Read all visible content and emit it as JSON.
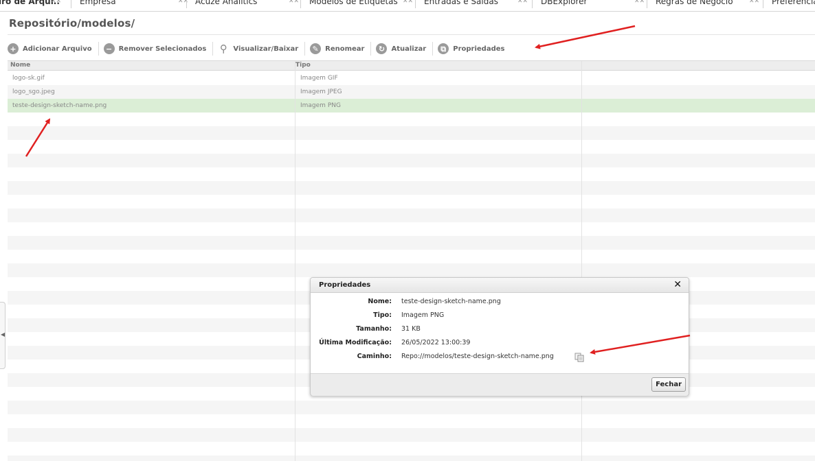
{
  "tabs": [
    {
      "label": "iro de Arqui.."
    },
    {
      "label": "Empresa"
    },
    {
      "label": "Acuze Analitics"
    },
    {
      "label": "Modelos de Etiquetas"
    },
    {
      "label": "Entradas e Saídas"
    },
    {
      "label": "DBExplorer"
    },
    {
      "label": "Regras de Negócio"
    },
    {
      "label": "Preferencias"
    }
  ],
  "header": {
    "title": "Repositório/modelos/"
  },
  "toolbar": {
    "add_label": "Adicionar Arquivo",
    "remove_label": "Remover Selecionados",
    "view_label": "Visualizar/Baixar",
    "rename_label": "Renomear",
    "refresh_label": "Atualizar",
    "properties_label": "Propriedades"
  },
  "grid": {
    "columns": [
      "Nome",
      "Tipo"
    ],
    "rows": [
      {
        "name": "logo-sk.gif",
        "type": "Imagem GIF"
      },
      {
        "name": "logo_sgo.jpeg",
        "type": "Imagem JPEG"
      },
      {
        "name": "teste-design-sketch-name.png",
        "type": "Imagem PNG",
        "selected": true
      }
    ]
  },
  "dialog": {
    "title": "Propriedades",
    "close_icon": "close-icon",
    "props": [
      {
        "label": "Nome:",
        "value": "teste-design-sketch-name.png"
      },
      {
        "label": "Tipo:",
        "value": "Imagem PNG"
      },
      {
        "label": "Tamanho:",
        "value": "31 KB"
      },
      {
        "label": "Última Modificação:",
        "value": "26/05/2022 13:00:39"
      },
      {
        "label": "Caminho:",
        "value": "Repo://modelos/teste-design-sketch-name.png"
      }
    ],
    "copy_icon": "copy-icon",
    "close_button": "Fechar"
  },
  "colors": {
    "selected_row": "#dbeed6",
    "annotation_arrow": "#e02020"
  }
}
